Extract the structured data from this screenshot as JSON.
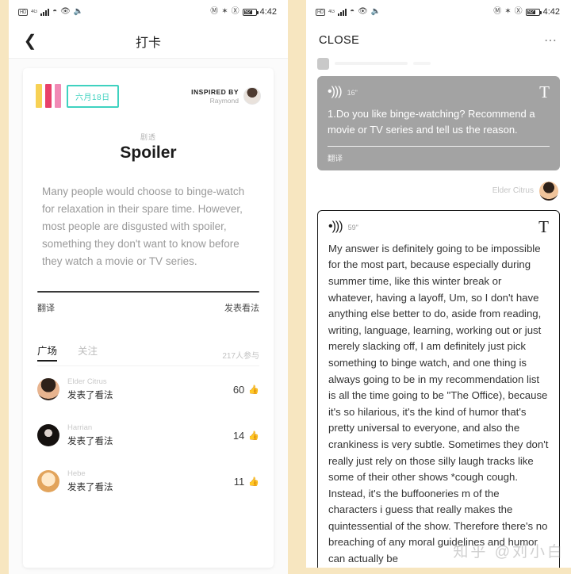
{
  "theme": {
    "background": "#f7e6c0",
    "accent_teal": "#3fd2c0",
    "bar_yellow": "#f7d154",
    "bar_crimson": "#e8406a",
    "bar_pink": "#f18ab5",
    "bubble_grey": "#a3a3a3"
  },
  "status_bar": {
    "hd_label": "HD",
    "signal_label": "4G",
    "time": "4:42",
    "battery_percent": "92",
    "icons": [
      "hd-icon",
      "signal-bars-icon",
      "wifi-icon",
      "eye-icon",
      "mute-icon",
      "nfc-icon",
      "bluetooth-icon",
      "alarm-off-icon",
      "battery-icon"
    ]
  },
  "left_panel": {
    "nav": {
      "back_icon": "chevron-left-icon",
      "title": "打卡"
    },
    "card": {
      "date_chip": "六月18日",
      "inspired_label": "INSPIRED BY",
      "inspired_name": "Raymond",
      "subtitle": "剧透",
      "title": "Spoiler",
      "paragraph": "Many people would choose to binge-watch for relaxation in their spare time. However, most people are disgusted with spoiler, something they don't want to know before they watch a movie or TV series.",
      "action_left": "翻译",
      "action_right": "发表看法"
    },
    "tabs": [
      {
        "label": "广场",
        "active": true
      },
      {
        "label": "关注",
        "active": false
      }
    ],
    "participants": "217人参与",
    "comments": [
      {
        "name": "Elder Citrus",
        "action": "发表了看法",
        "count": "60",
        "like_icon": "thumb-up-icon"
      },
      {
        "name": "Harrian",
        "action": "发表了看法",
        "count": "14",
        "like_icon": "thumb-up-icon"
      },
      {
        "name": "Hebe",
        "action": "发表了看法",
        "count": "11",
        "like_icon": "thumb-up-icon"
      }
    ]
  },
  "right_panel": {
    "nav": {
      "close_label": "CLOSE",
      "more_icon": "more-horizontal-icon"
    },
    "question_bubble": {
      "audio_icon": "sound-wave-icon",
      "duration": "16\"",
      "text_icon": "T",
      "text": "1.Do you like binge-watching? Recommend a movie or TV series and tell us the reason.",
      "translate_label": "翻译"
    },
    "answer_user": {
      "name": "Elder Citrus",
      "avatar": "user-avatar"
    },
    "answer_bubble": {
      "audio_icon": "sound-wave-icon",
      "duration": "59\"",
      "text_icon": "T",
      "text": "My answer is definitely going to be impossible for the most part, because especially during summer time, like this winter break or whatever, having a layoff, Um, so I don't have anything else better to do, aside from reading, writing, language, learning, working out or just merely slacking off, I am definitely just pick something to binge watch, and one thing is always going to be in my recommendation list is all the time going to be \"The Office), because it's so hilarious, it's the kind of humor that's pretty universal to everyone, and also the crankiness is very subtle. Sometimes they don't really just rely on those silly laugh tracks like some of their other shows *cough cough. Instead, it's the buffooneries m of the characters i guess that really makes the quintessential of the show. Therefore there's no breaching of any moral guidelines and humor can actually be"
    },
    "watermark": "知乎 @刘小白"
  }
}
